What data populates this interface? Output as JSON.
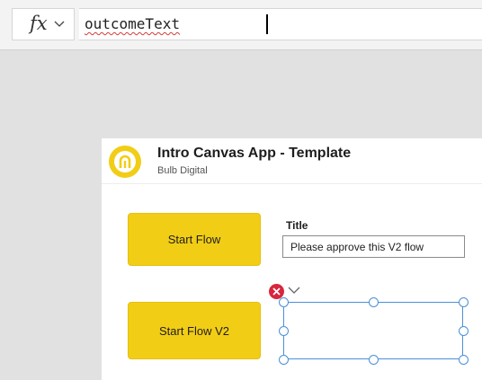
{
  "formula_bar": {
    "fx_label": "fx",
    "formula": "outcomeText",
    "error_underline_color": "#d23b3b"
  },
  "app": {
    "title": "Intro Canvas App - Template",
    "subtitle": "Bulb Digital",
    "logo_icon": "bulb-logo-icon",
    "brand_color": "#f2cd15"
  },
  "controls": {
    "start_flow_label": "Start Flow",
    "start_flow_v2_label": "Start Flow V2",
    "title_label": "Title",
    "title_value": "Please approve this V2 flow"
  },
  "selection": {
    "selection_color": "#4a90d9",
    "delete_icon": "close-icon",
    "delete_color": "#d7263d"
  }
}
